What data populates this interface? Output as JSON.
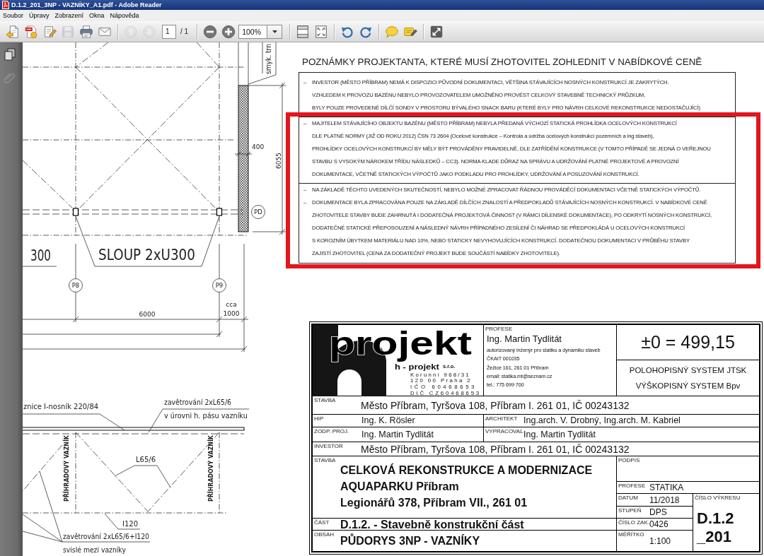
{
  "window": {
    "title": "D.1.2_201_3NP - VAZNÍKY_A1.pdf - Adobe Reader"
  },
  "menu": [
    "Soubor",
    "Úpravy",
    "Zobrazení",
    "Okna",
    "Nápověda"
  ],
  "toolbar": {
    "file_buttons": [
      {
        "disabled": false
      },
      {
        "disabled": false
      },
      {
        "disabled": false
      },
      {
        "disabled": true
      },
      {
        "disabled": false
      },
      {
        "disabled": false
      }
    ],
    "page_buttons": [
      {
        "disabled": true
      },
      {
        "disabled": true
      }
    ],
    "page": {
      "value": "1",
      "total": "/ 1"
    },
    "zoom_buttons": [
      {
        "disabled": false
      },
      {
        "disabled": false
      }
    ],
    "zoom": {
      "value": "100%"
    },
    "view_buttons": [
      {
        "disabled": false
      },
      {
        "disabled": false
      }
    ],
    "rotate_buttons": [
      {
        "disabled": false
      },
      {
        "disabled": false
      }
    ],
    "comment_buttons": [
      {
        "disabled": false
      },
      {
        "disabled": false
      }
    ],
    "screen_buttons": [
      {
        "disabled": false
      }
    ]
  },
  "nav_panel": {
    "buttons": [
      {
        "disabled": false
      },
      {
        "disabled": true
      }
    ]
  },
  "drawing": {
    "labels": [
      {
        "kind": "vertical",
        "text": "smyk. trn"
      },
      {
        "kind": "text",
        "text": "400"
      },
      {
        "kind": "vertical",
        "text": "6055"
      },
      {
        "kind": "mark",
        "text": "PD"
      },
      {
        "kind": "text",
        "text": "300"
      },
      {
        "kind": "text",
        "text": "SLOUP 2xU300"
      },
      {
        "kind": "mark",
        "text": "P8"
      },
      {
        "kind": "mark",
        "text": "P9"
      },
      {
        "kind": "text",
        "text": "6000"
      },
      {
        "kind": "text",
        "text": "cca"
      },
      {
        "kind": "text",
        "text": "1000"
      },
      {
        "kind": "text",
        "text": "znice I-nosník 220/84"
      },
      {
        "kind": "text",
        "text": "zavětrování 2xL65/6"
      },
      {
        "kind": "text",
        "text": "v úrovni h. pásu vazníku"
      },
      {
        "kind": "vertical",
        "text": "PŘÍHRADOVÝ VAZNÍK"
      },
      {
        "kind": "vertical",
        "text": "PŘÍHRADOVÝ VAZNÍK"
      },
      {
        "kind": "text",
        "text": "L65/6"
      },
      {
        "kind": "text",
        "text": "I120"
      },
      {
        "kind": "text",
        "text": "zavětrování 2xL65/6+I120"
      },
      {
        "kind": "text",
        "text": "svislé mezi vazníky"
      }
    ]
  },
  "notes": {
    "heading": "POZNÁMKY PROJEKTANTA, KTERÉ MUSÍ ZHOTOVITEL ZOHLEDNIT V NABÍDKOVÉ CENĚ",
    "sections": [
      {
        "highlighted": false,
        "paragraphs": [
          {
            "bullet": "–",
            "lines": [
              "INVESTOR (MĚSTO PŘÍBRAM) NEMÁ K DISPOZICI PŮVODNÍ DOKUMENTACI, VĚTŠINA STÁVAJÍCÍCH NOSNÝCH KONSTRUKCÍ JE ZAKRYTÝCH.",
              "VZHLEDEM K PROVOZU BAZÉNU NEBYLO PROVOZOVATELEM UMOŽNĚNO PROVÉST CELKOVÝ STAVEBNĚ TECHNICKÝ PRŮZKUM,",
              "BYLY POUZE PROVEDENÉ DÍLČÍ SONDY V PROSTORU BÝVALÉHO SNACK BARU (KTERÉ BYLY PRO NÁVRH CELKOVÉ REKONSTRUKCE NEDOSTAČUJÍCÍ)"
            ]
          }
        ]
      },
      {
        "highlighted": true,
        "paragraphs": [
          {
            "bullet": "–",
            "lines": [
              "MAJITELEM STÁVAJÍCÍHO OBJEKTU BAZÉNU (MĚSTO PŘÍBRAM) NEBYLA PŘEDANÁ VÝCHOZÍ STATICKÁ PROHLÍDKA OCELOVÝCH KONSTRUKCÍ",
              "DLE PLATNÉ NORMY (JIŽ OD ROKU 2012) ČSN 73 2604 (Ocelové konstrukce – Kontrola a údržba ocelových konstrukcí pozemních a ing staveb),",
              "PROHLÍDKY OCELOVÝCH KONSTRUKCÍ BY MĚLY BÝT PROVÁDĚNY PRAVIDELNĚ, DLE ZATŘÍDĚNÍ KONSTRUKCE (V TOMTO PŘÍPADĚ SE JEDNÁ O VEŘEJNOU",
              "STAVBU S VYSOKÝM NÁROKEM TŘÍDU NÁSLEDKŮ – CC3). NORMA KLADE DŮRAZ NA SPRÁVU A UDRŽOVÁNÍ PLATNÉ PROJEKTOVÉ A PROVOZNÍ",
              "DOKUMENTACE, VČETNĚ STATICKÝCH VÝPOČTŮ JAKO PODKLADU PRO PROHLÍDKY, UDRŽOVÁNÍ A POSUZOVÁNÍ KONSTRUKCÍ."
            ]
          }
        ]
      },
      {
        "highlighted": true,
        "paragraphs": [
          {
            "bullet": "–",
            "lines": [
              "NA ZÁKLADĚ TĚCHTO UVEDENÝCH SKUTEČNOSTÍ, NEBYLO MOŽNÉ ZPRACOVAT ŘÁDNOU PROVÁDĚCÍ DOKUMENTACI VČETNĚ STATICKÝCH VÝPOČTŮ."
            ]
          },
          {
            "bullet": "–",
            "lines": [
              "DOKUMENTACE BYLA ZPRACOVÁNA POUZE NA ZÁKLADĚ DÍLČÍCH ZNALOSTÍ A PŘEDPOKLADŮ STÁVAJÍCÍCH NOSNÝCH KONSTRUKCÍ. V NABÍDKOVÉ CENĚ",
              "ZHOTOVITELE STAVBY BUDE ZAHRNUTÁ I DODATEČNÁ PROJEKTOVÁ ČINNOST (V RÁMCI DÍLENSKÉ DOKUMENTACE), PO ODKRYTÍ NOSNÝCH KONSTRUKCÍ,",
              "DODATEČNÉ STATICKÉ PŘEPOSOUZENÍ A NÁSLEDNÝ NÁVRH PŘÍPADNÉHO ZESÍLENÍ ČI NÁHRAD SE PŘEDPOKLÁDÁ U OCELOVÝCH KONSTRUKCÍ",
              "S KOROZNÍM ÚBYTKEM MATERIÁLU NAD 10%, NEBO STATICKY NEVYHOVUJÍCÍCH KONSTRUKCÍ. DODATEČNOU DOKUMENTACI V PRŮBĚHU STAVBY",
              "ZAJISTÍ ZHOTOVITEL (CENA ZA DODATEČNÝ PROJEKT BUDE SOUČÁSTÍ NABÍDKY ZHOTOVITELE)."
            ]
          }
        ]
      }
    ]
  },
  "title_block": {
    "logo": {
      "wordmark": "projekt",
      "company": "h - projekt",
      "legal_form": "s.r.o.",
      "address": [
        "Korunní 968/31",
        "120 00 Praha 2",
        "IČO 60468653",
        "DIČ CZ60468653"
      ]
    },
    "designer": {
      "label": "PROFESE",
      "name": "Ing. Martin Tydlitát",
      "details": [
        "autorizovaný inženýr pro statiku a dynamiku staveb",
        "ČKAIT 001035",
        "Žežice 161, 261 01 Příbram",
        "email: statika.mt@seznam.cz",
        "tel.: 775 699 700"
      ]
    },
    "elevation": "±0 = 499,15",
    "systems": [
      "POLOHOPISNÝ SYSTEM JTSK",
      "VÝŠKOPISNÝ SYSTEM Bpv"
    ],
    "site": {
      "label": "STAVBA",
      "value": "Město Příbram, Tyršova 108, Příbram I. 261 01, IČ 00243132"
    },
    "chief_engineer": {
      "label": "HIP",
      "value": "Ing. K. Rösler"
    },
    "architect": {
      "label": "ARCHITEKT",
      "value": "Ing.arch. V. Drobný, Ing.arch. M. Kabriel"
    },
    "responsible_designer": {
      "label": "ZODP. PROJ.",
      "value": "Ing. Martin Tydlitát"
    },
    "prepared_by": {
      "label": "VYPRACOVAL",
      "value": "Ing. Martin Tydlitát"
    },
    "investor": {
      "label": "INVESTOR",
      "value": "Město Příbram, Tyršova 108, Příbram I. 261 01, IČ 00243132"
    },
    "project": {
      "label": "STAVBA",
      "lines": [
        "CELKOVÁ REKONSTRUKCE A MODERNIZACE",
        "AQUAPARKU Příbram",
        "Legionářů 378, Příbram VII., 261 01"
      ]
    },
    "signature": {
      "label": "PODPIS"
    },
    "profession": {
      "label": "PROFESE",
      "value": "STATIKA"
    },
    "date": {
      "label": "DATUM",
      "value": "11/2018"
    },
    "stage": {
      "label": "STUPEŇ",
      "value": "DPS"
    },
    "drawing_number": {
      "label": "ČÍSLO VÝKRESU",
      "lines": [
        "D.1.2",
        "_201"
      ]
    },
    "part": {
      "label": "ČÁST",
      "value": "D.1.2. - Stavebně konstrukční část"
    },
    "order_number": {
      "label": "ČÍSLO ZAK.",
      "value": "0426"
    },
    "content": {
      "label": "OBSAH",
      "value": "PŮDORYS 3NP - VAZNÍKY"
    },
    "scale": {
      "label": "MĚŘÍTKO",
      "value": "1:100"
    }
  }
}
